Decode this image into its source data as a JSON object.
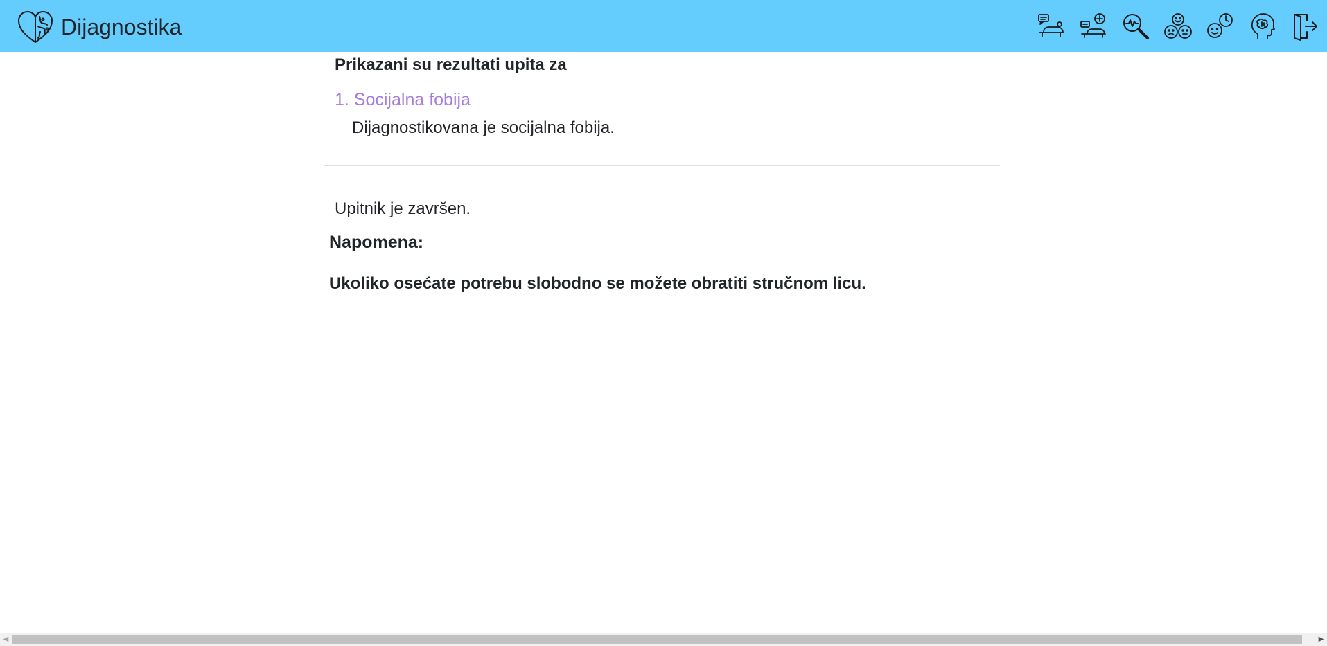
{
  "navbar": {
    "brand_label": "Dijagnostika",
    "bg_color": "#64cdfe",
    "icons": [
      "therapy-chat-icon",
      "add-consultation-icon",
      "diagnosis-search-icon",
      "emotions-icon",
      "mood-history-icon",
      "mind-profile-icon",
      "logout-door-icon"
    ]
  },
  "results": {
    "title": "Prikazani su rezultati upita za",
    "items": [
      {
        "label": "1. Socijalna fobija",
        "description": "Dijagnostikovana je socijalna fobija."
      }
    ]
  },
  "status": {
    "finished": "Upitnik je završen."
  },
  "note": {
    "label": "Napomena:",
    "text": "Ukoliko osećate potrebu slobodno se možete obratiti stručnom licu."
  },
  "colors": {
    "accent": "#a77ddc",
    "text": "#212529"
  }
}
